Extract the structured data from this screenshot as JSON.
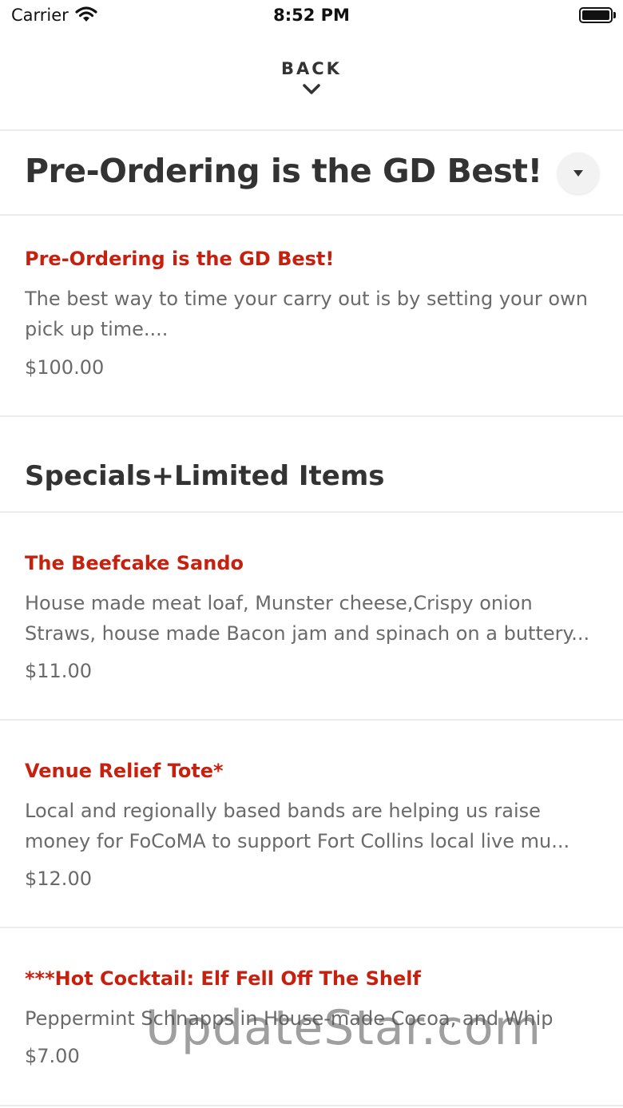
{
  "status_bar": {
    "carrier": "Carrier",
    "time": "8:52 PM"
  },
  "nav": {
    "back_label": "BACK"
  },
  "header": {
    "title": "Pre-Ordering is the GD Best!"
  },
  "featured": {
    "name": "Pre-Ordering is the GD Best!",
    "desc_line1": "The best way to time your carry out is by setting your own",
    "desc_line2": "pick up time....",
    "price": "$100.00"
  },
  "section": {
    "title": "Specials+Limited Items"
  },
  "items": [
    {
      "name": "The Beefcake Sando",
      "desc_line1": "House made meat loaf, Munster cheese,Crispy onion",
      "desc_line2": "Straws, house made Bacon jam and spinach on a buttery...",
      "price": "$11.00"
    },
    {
      "name": "Venue Relief Tote*",
      "desc_line1": "Local and regionally based bands are helping us raise",
      "desc_line2": "money for FoCoMA to support Fort Collins local live mu...",
      "price": "$12.00"
    },
    {
      "name": "***Hot Cocktail: Elf Fell Off The Shelf",
      "desc_line1": "Peppermint Schnapps in House-made Cocoa, and Whip",
      "price": "$7.00"
    }
  ],
  "watermark": "UpdateStar.com",
  "colors": {
    "accent": "#c8200f",
    "text": "#333333",
    "muted": "#6a6a6a",
    "divider": "#ececec"
  }
}
